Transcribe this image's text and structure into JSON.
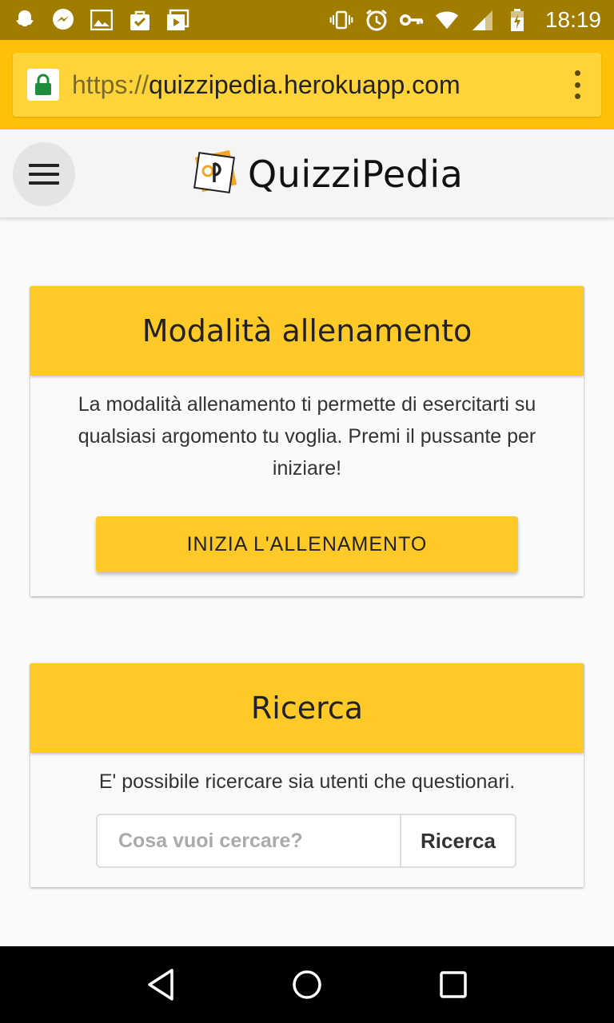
{
  "status_bar": {
    "time": "18:19",
    "left_icons": [
      "snapchat-icon",
      "messenger-icon",
      "gallery-icon",
      "shopping-bag-icon",
      "play-store-icon"
    ],
    "right_icons": [
      "vibrate-icon",
      "alarm-icon",
      "key-icon",
      "wifi-icon",
      "signal-icon",
      "battery-icon"
    ]
  },
  "browser": {
    "url_scheme": "https://",
    "url_host": "quizzipedia.herokuapp.com",
    "lock_icon": "lock-icon",
    "menu_icon": "more-vert-icon"
  },
  "navbar": {
    "brand_title": "QuizziPedia",
    "menu_icon": "hamburger-icon",
    "logo_icon": "quizzipedia-logo"
  },
  "training_card": {
    "title": "Modalità allenamento",
    "description": "La modalità allenamento ti permette di esercitarti su qualsiasi argomento tu voglia. Premi il pussante per iniziare!",
    "button_label": "INIZIA L'ALLENAMENTO"
  },
  "search_card": {
    "title": "Ricerca",
    "description": "E' possibile ricercare sia utenti che questionari.",
    "input_placeholder": "Cosa vuoi cercare?",
    "input_value": "",
    "button_label": "Ricerca"
  },
  "nav_bar": {
    "icons": [
      "back-icon",
      "home-icon",
      "recents-icon"
    ]
  },
  "colors": {
    "status_bar": "#a07c00",
    "accent": "#ffc107",
    "card_header": "#ffca28"
  }
}
